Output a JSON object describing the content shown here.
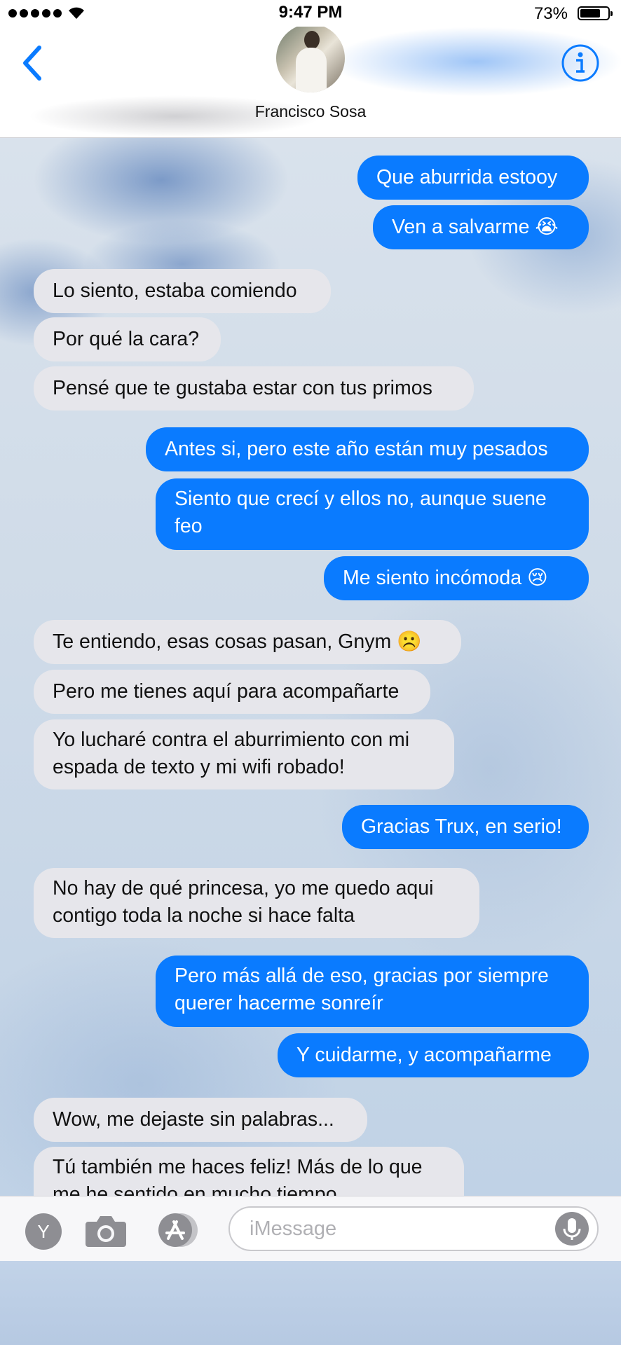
{
  "status_bar": {
    "time": "9:47 PM",
    "battery_percent": "73%",
    "battery_level": 0.73
  },
  "header": {
    "contact_name": "Francisco Sosa",
    "back_icon": "chevron-left-icon",
    "info_icon": "info-icon"
  },
  "messages": [
    {
      "from": "me",
      "text": "Que aburrida estooy"
    },
    {
      "from": "me",
      "text": "Ven a salvarme 😭"
    },
    {
      "from": "them",
      "text": "Lo siento, estaba comiendo"
    },
    {
      "from": "them",
      "text": "Por qué la cara?"
    },
    {
      "from": "them",
      "text": "Pensé que te gustaba estar con tus primos"
    },
    {
      "from": "me",
      "text": "Antes si, pero este año están muy pesados"
    },
    {
      "from": "me",
      "text": "Siento que crecí y ellos no, aunque suene feo"
    },
    {
      "from": "me",
      "text": "Me siento incómoda 😢"
    },
    {
      "from": "them",
      "text": "Te entiendo, esas cosas pasan, Gnym ☹️"
    },
    {
      "from": "them",
      "text": "Pero me tienes aquí para acompañarte"
    },
    {
      "from": "them",
      "text": "Yo lucharé contra el aburrimiento con mi espada de texto y mi wifi robado!"
    },
    {
      "from": "me",
      "text": "Gracias Trux, en serio!"
    },
    {
      "from": "them",
      "text": "No hay de qué princesa, yo me quedo aqui contigo toda la noche si hace falta"
    },
    {
      "from": "me",
      "text": "Pero más allá de eso, gracias por siempre querer hacerme sonreír"
    },
    {
      "from": "me",
      "text": "Y cuidarme, y acompañarme"
    },
    {
      "from": "them",
      "text": "Wow, me dejaste sin palabras..."
    },
    {
      "from": "them",
      "text": "Tú también me haces feliz! Más de lo que me he sentido en mucho tiempo"
    }
  ],
  "input_bar": {
    "y_button_label": "Y",
    "camera_icon": "camera-icon",
    "apps_icon": "app-store-icon",
    "message_placeholder": "iMessage",
    "message_value": "",
    "mic_icon": "microphone-icon"
  },
  "colors": {
    "outgoing_bubble": "#0a7bff",
    "incoming_bubble": "#e6e6eb",
    "accent": "#0a7bff"
  }
}
